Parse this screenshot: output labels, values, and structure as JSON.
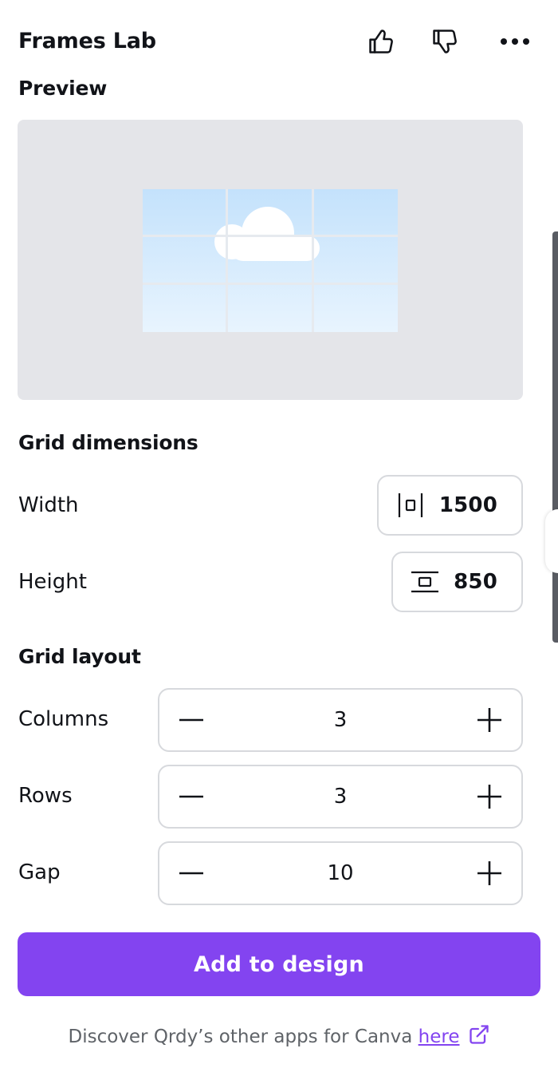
{
  "header": {
    "app_title": "Frames Lab",
    "icons": [
      "thumbs-up-icon",
      "thumbs-down-icon",
      "more-icon"
    ]
  },
  "preview": {
    "title": "Preview",
    "columns": 3,
    "rows": 3,
    "image": "sky-with-cloud"
  },
  "grid_dimensions": {
    "title": "Grid dimensions",
    "width_label": "Width",
    "width_value": "1500",
    "height_label": "Height",
    "height_value": "850"
  },
  "grid_layout": {
    "title": "Grid layout",
    "columns_label": "Columns",
    "columns_value": "3",
    "rows_label": "Rows",
    "rows_value": "3",
    "gap_label": "Gap",
    "gap_value": "10"
  },
  "actions": {
    "add_label": "Add to design"
  },
  "footer": {
    "text": "Discover Qrdy’s other apps for Canva",
    "link_label": "here"
  },
  "colors": {
    "accent": "#8344f0",
    "preview_bg": "#e4e5e9",
    "border": "#d7d9dd"
  }
}
